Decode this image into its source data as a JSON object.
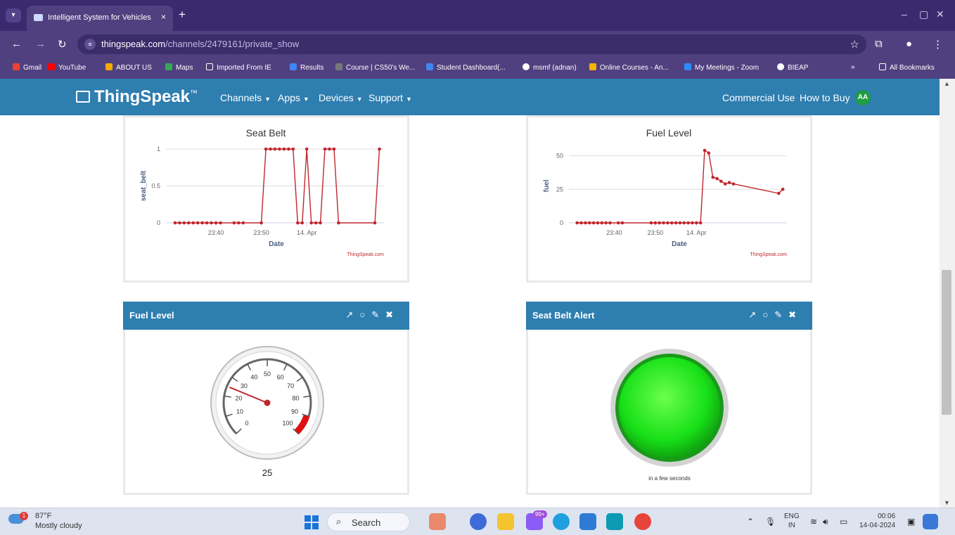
{
  "browser": {
    "tab_title": "Intelligent System for Vehicles -",
    "tab_close": "×",
    "new_tab": "+",
    "url_domain": "thingspeak.com",
    "url_path": "/channels/2479161/private_show",
    "bookmarks": [
      "Gmail",
      "YouTube",
      "ABOUT US",
      "Maps",
      "Imported From IE",
      "Results",
      "Course | CS50's We...",
      "Student Dashboard(...",
      "msmf (adnan)",
      "Online Courses - An...",
      "My Meetings - Zoom",
      "BIEAP",
      "»",
      "All Bookmarks"
    ]
  },
  "nav": {
    "brand": "ThingSpeak",
    "brand_tm": "™",
    "links": [
      "Channels",
      "Apps",
      "Devices",
      "Support"
    ],
    "right_links": [
      "Commercial Use",
      "How to Buy"
    ],
    "avatar": "AA"
  },
  "chart_data": [
    {
      "type": "line",
      "title": "Seat Belt",
      "xlabel": "Date",
      "ylabel": "seat_belt",
      "credit": "ThingSpeak.com",
      "x_ticks": [
        "23:40",
        "23:50",
        "14. Apr"
      ],
      "y_ticks": [
        "0",
        "0.5",
        "1"
      ],
      "ylim": [
        0,
        1
      ],
      "color": "#c0272d",
      "series": [
        {
          "x": [
            "23:31",
            "23:32",
            "23:33",
            "23:34",
            "23:35",
            "23:36",
            "23:37",
            "23:38",
            "23:39",
            "23:40",
            "23:41",
            "23:44",
            "23:45",
            "23:46",
            "23:50",
            "23:51",
            "23:52",
            "23:53",
            "23:54",
            "23:55",
            "23:56",
            "23:57",
            "23:58",
            "23:59",
            "00:00",
            "00:01",
            "00:02",
            "00:03",
            "00:04",
            "00:05",
            "00:06",
            "00:07",
            "00:15",
            "00:16"
          ],
          "y": [
            0,
            0,
            0,
            0,
            0,
            0,
            0,
            0,
            0,
            0,
            0,
            0,
            0,
            0,
            0,
            1,
            1,
            1,
            1,
            1,
            1,
            1,
            0,
            0,
            1,
            0,
            0,
            0,
            1,
            1,
            1,
            0,
            0,
            1
          ]
        }
      ]
    },
    {
      "type": "line",
      "title": "Fuel Level",
      "xlabel": "Date",
      "ylabel": "fuel",
      "credit": "ThingSpeak.com",
      "x_ticks": [
        "23:40",
        "23:50",
        "14. Apr"
      ],
      "y_ticks": [
        "0",
        "25",
        "50"
      ],
      "ylim": [
        0,
        55
      ],
      "color": "#c0272d",
      "series": [
        {
          "x": [
            "23:31",
            "23:32",
            "23:33",
            "23:34",
            "23:35",
            "23:36",
            "23:37",
            "23:38",
            "23:39",
            "23:41",
            "23:42",
            "23:49",
            "23:50",
            "23:51",
            "23:52",
            "23:53",
            "23:54",
            "23:55",
            "23:56",
            "23:57",
            "23:58",
            "23:59",
            "00:00",
            "00:01",
            "00:02",
            "00:03",
            "00:04",
            "00:05",
            "00:06",
            "00:07",
            "00:08",
            "00:09",
            "00:20",
            "00:21"
          ],
          "y": [
            0,
            0,
            0,
            0,
            0,
            0,
            0,
            0,
            0,
            0,
            0,
            0,
            0,
            0,
            0,
            0,
            0,
            0,
            0,
            0,
            0,
            0,
            0,
            0,
            54,
            52,
            34,
            33,
            31,
            29,
            30,
            29,
            22,
            25
          ]
        }
      ]
    }
  ],
  "widgets": {
    "fuel_gauge": {
      "title": "Fuel Level",
      "min": 0,
      "max": 100,
      "value": 25,
      "value_label": "25",
      "ticks": [
        "0",
        "10",
        "20",
        "30",
        "40",
        "50",
        "60",
        "70",
        "80",
        "90",
        "100"
      ],
      "danger_range": [
        90,
        100
      ],
      "danger_color": "#e01010"
    },
    "seat_belt_lamp": {
      "title": "Seat Belt Alert",
      "status_text": "in a few seconds",
      "lamp_color": "#22dd22"
    },
    "action_icons": [
      "external-link-icon",
      "comment-icon",
      "pencil-icon",
      "close-icon"
    ]
  },
  "taskbar": {
    "temp": "87°F",
    "weather": "Mostly cloudy",
    "weather_badge": "1",
    "search": "Search",
    "badge": "99+",
    "lang_top": "ENG",
    "lang_bottom": "IN",
    "time": "00:06",
    "date": "14-04-2024"
  }
}
